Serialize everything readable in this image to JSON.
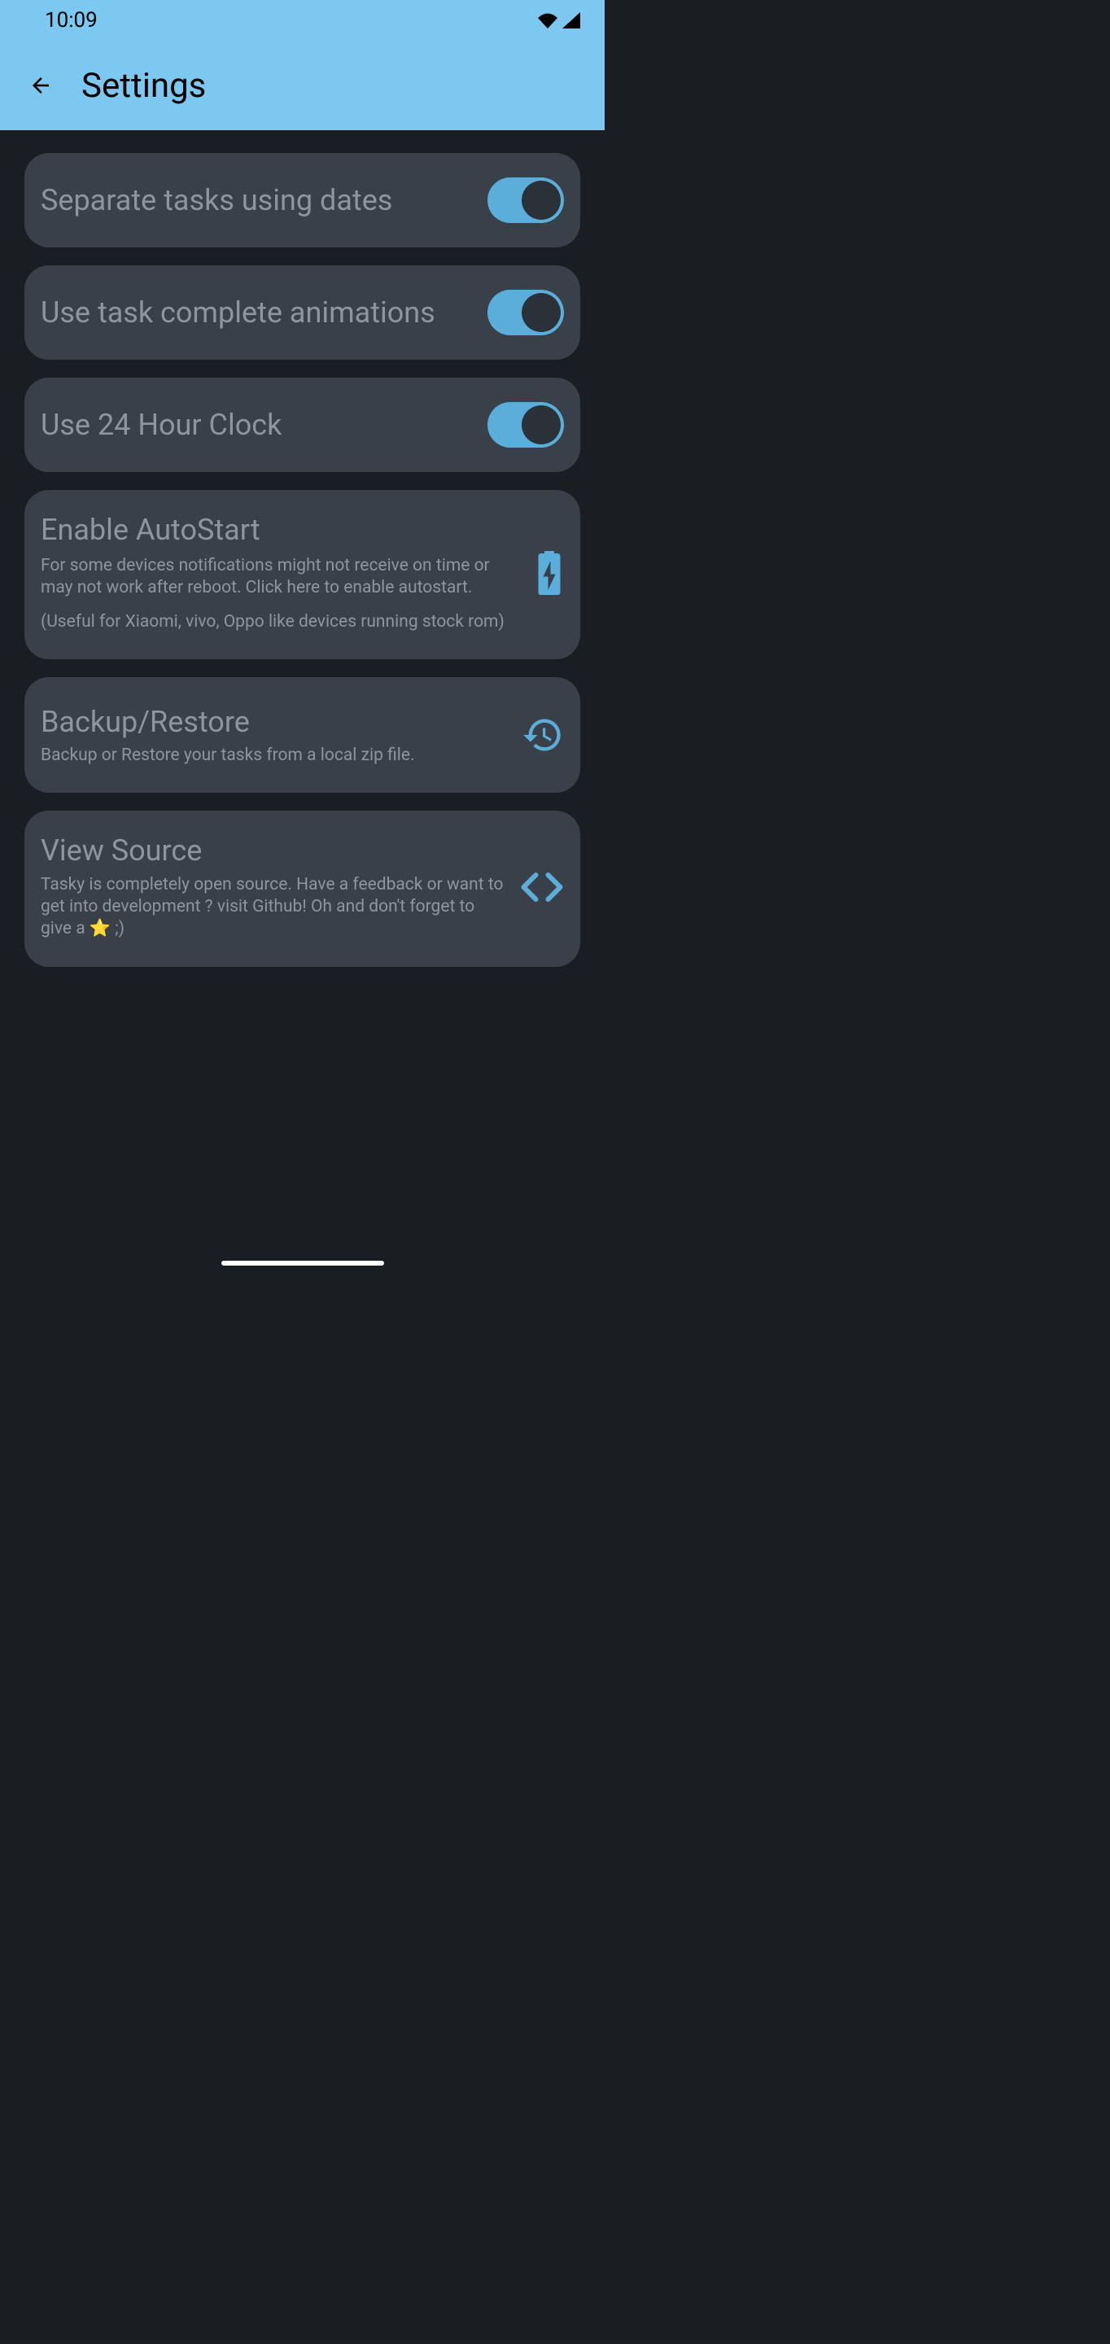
{
  "statusBar": {
    "time": "10:09"
  },
  "header": {
    "title": "Settings"
  },
  "settings": [
    {
      "title": "Separate tasks using dates",
      "enabled": true
    },
    {
      "title": "Use task complete animations",
      "enabled": true
    },
    {
      "title": "Use 24 Hour Clock",
      "enabled": true
    }
  ],
  "autostart": {
    "title": "Enable AutoStart",
    "description": "For some devices notifications might not receive on time or may not work after reboot. Click here to enable autostart.",
    "note": "(Useful for Xiaomi, vivo, Oppo like devices running stock rom)"
  },
  "backup": {
    "title": "Backup/Restore",
    "description": "Backup or Restore your tasks from a local zip file."
  },
  "source": {
    "title": "View Source",
    "description": "Tasky is completely open source. Have a feedback or want to get into development ? visit Github! Oh and don't forget to give a ⭐ ;)"
  }
}
